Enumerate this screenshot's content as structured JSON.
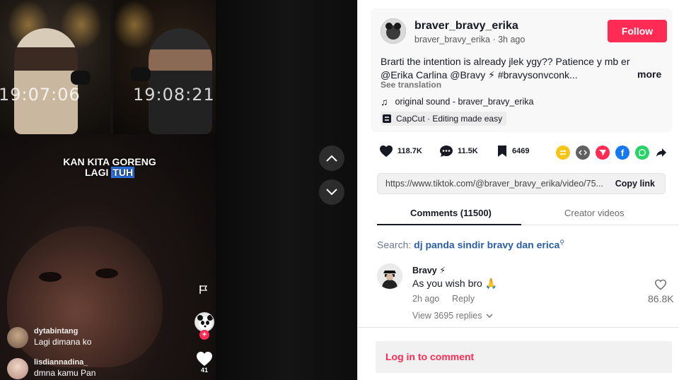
{
  "video": {
    "timestamp_left": "19:07:06",
    "timestamp_right": "19:08:21",
    "caption_line1": "KAN KITA GORENG",
    "caption_line2_plain": "LAGI",
    "caption_line2_highlight": "TUH",
    "heart_count": "41",
    "live_comments": [
      {
        "user": "dytabintang",
        "text": "Lagi dimana ko"
      },
      {
        "user": "lisdiannadina_",
        "text": "dmna kamu Pan"
      }
    ]
  },
  "post": {
    "author_name": "braver_bravy_erika",
    "author_handle": "braver_bravy_erika · 3h ago",
    "follow_label": "Follow",
    "description_line1": "Brarti the intention is already jlek ygy?? Patience y mb er",
    "description_line2": "@Erika Carlina @Bravy ⚡ #bravysonvconk...",
    "more_label": "more",
    "see_translation": "See translation",
    "music": "original sound - braver_bravy_erika",
    "capcut": "CapCut · Editing made easy"
  },
  "actions": {
    "likes": "118.7K",
    "comments": "11.5K",
    "saves": "6469"
  },
  "share_colors": {
    "repost": "#f5c518",
    "embed": "#616161",
    "send": "#fe2c55",
    "facebook": "#1877f2",
    "whatsapp": "#25d366"
  },
  "link": {
    "url": "https://www.tiktok.com/@braver_bravy_erika/video/75...",
    "copy_label": "Copy link"
  },
  "tabs": {
    "comments": "Comments (11500)",
    "creator_videos": "Creator videos"
  },
  "search": {
    "label": "Search:",
    "query": "dj panda sindir bravy dan erica"
  },
  "comment": {
    "user": "Bravy ⚡",
    "text": "As you wish bro 🙏",
    "time": "2h ago",
    "reply_label": "Reply",
    "like_count": "86.8K",
    "view_replies": "View 3695 replies"
  },
  "login": {
    "label": "Log in to comment"
  }
}
